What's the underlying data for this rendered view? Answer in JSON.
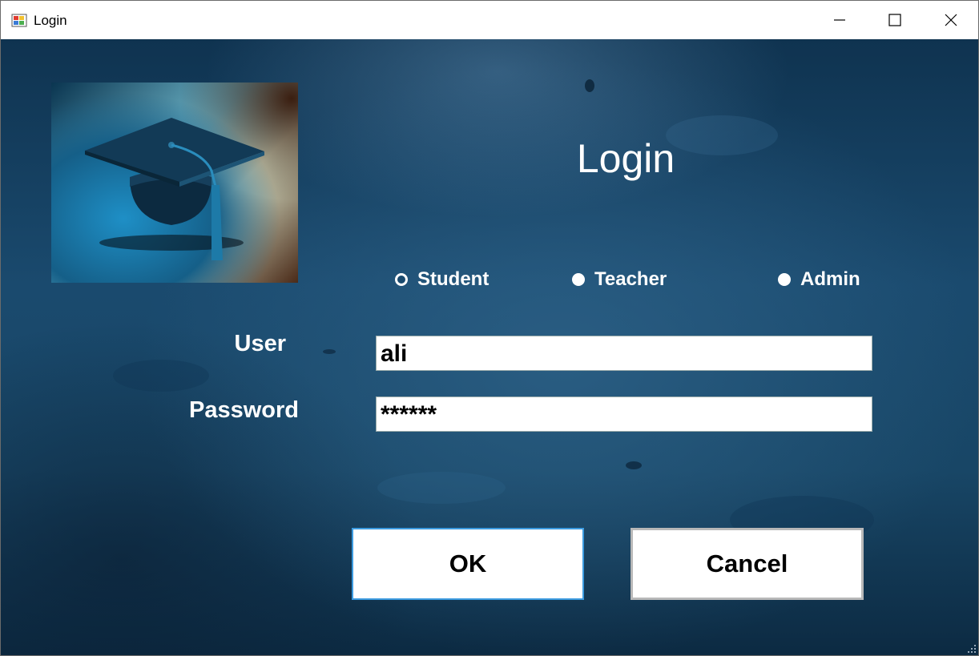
{
  "window": {
    "title": "Login"
  },
  "form": {
    "heading": "Login",
    "roles": [
      {
        "label": "Student",
        "checked": true
      },
      {
        "label": "Teacher",
        "checked": false
      },
      {
        "label": "Admin",
        "checked": false
      }
    ],
    "user_label": "User",
    "user_value": "ali",
    "password_label": "Password",
    "password_value": "******",
    "ok_label": "OK",
    "cancel_label": "Cancel"
  },
  "icons": {
    "app": "windows-form-icon",
    "logo": "graduation-cap-icon",
    "minimize": "minimize-icon",
    "maximize": "maximize-icon",
    "close": "close-icon"
  },
  "colors": {
    "background": "#184666",
    "text": "#ffffff",
    "ok_border": "#3c9be0"
  }
}
